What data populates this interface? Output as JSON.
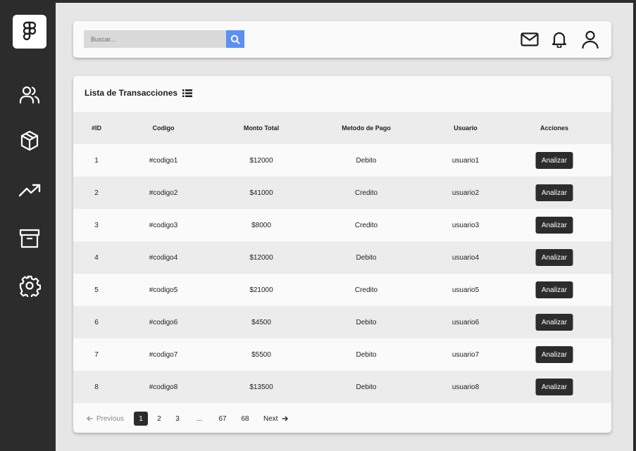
{
  "colors": {
    "sidebar": "#2c2c2c",
    "search_button": "#5b8ff5",
    "background": "#e6e6e6",
    "card": "#fafafa"
  },
  "sidebar": {
    "logo": "figma-logo-icon",
    "items": [
      {
        "icon": "users-icon"
      },
      {
        "icon": "box-icon"
      },
      {
        "icon": "trending-up-icon"
      },
      {
        "icon": "archive-icon"
      },
      {
        "icon": "settings-icon"
      }
    ]
  },
  "topbar": {
    "search_placeholder": "Buscar...",
    "icons": [
      "mail-icon",
      "bell-icon",
      "user-icon"
    ]
  },
  "card": {
    "title": "Lista de Transacciones",
    "title_icon": "list-icon"
  },
  "table": {
    "headers": [
      "#ID",
      "Codigo",
      "Monto Total",
      "Metodo de Pago",
      "Usuario",
      "Acciones"
    ],
    "rows": [
      {
        "id": "1",
        "codigo": "#codigo1",
        "monto": "$12000",
        "metodo": "Debito",
        "usuario": "usuario1",
        "accion": "Analizar"
      },
      {
        "id": "2",
        "codigo": "#codigo2",
        "monto": "$41000",
        "metodo": "Credito",
        "usuario": "usuario2",
        "accion": "Analizar"
      },
      {
        "id": "3",
        "codigo": "#codigo3",
        "monto": "$8000",
        "metodo": "Credito",
        "usuario": "usuario3",
        "accion": "Analizar"
      },
      {
        "id": "4",
        "codigo": "#codigo4",
        "monto": "$12000",
        "metodo": "Debito",
        "usuario": "usuario4",
        "accion": "Analizar"
      },
      {
        "id": "5",
        "codigo": "#codigo5",
        "monto": "$21000",
        "metodo": "Credito",
        "usuario": "usuario5",
        "accion": "Analizar"
      },
      {
        "id": "6",
        "codigo": "#codigo6",
        "monto": "$4500",
        "metodo": "Debito",
        "usuario": "usuario6",
        "accion": "Analizar"
      },
      {
        "id": "7",
        "codigo": "#codigo7",
        "monto": "$5500",
        "metodo": "Debito",
        "usuario": "usuario7",
        "accion": "Analizar"
      },
      {
        "id": "8",
        "codigo": "#codigo8",
        "monto": "$13500",
        "metodo": "Debito",
        "usuario": "usuario8",
        "accion": "Analizar"
      }
    ]
  },
  "pagination": {
    "previous": "Previous",
    "next": "Next",
    "pages": [
      "1",
      "2",
      "3",
      "...",
      "67",
      "68"
    ],
    "current": "1"
  }
}
